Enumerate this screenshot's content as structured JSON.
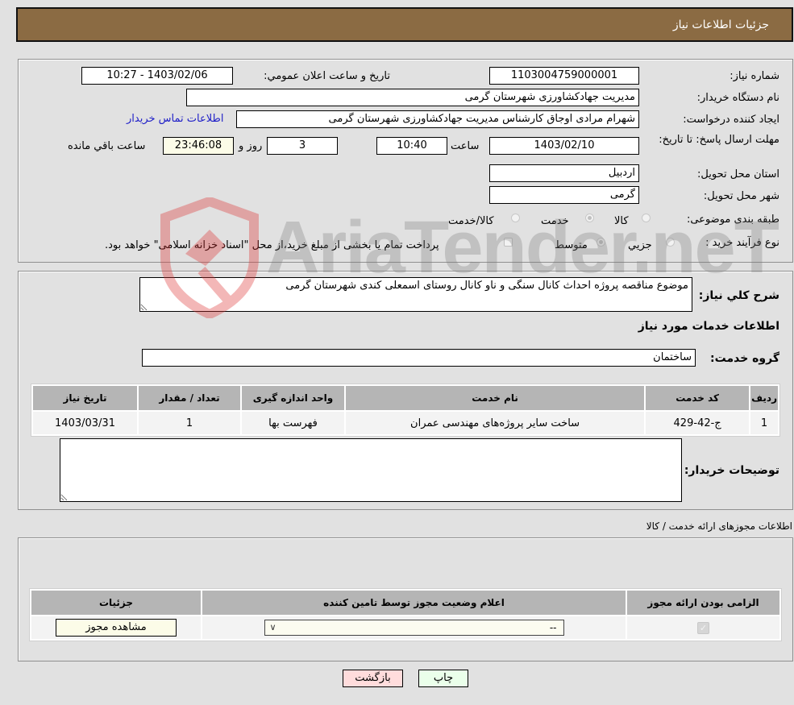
{
  "header": {
    "title": "جزئیات اطلاعات نیاز"
  },
  "form": {
    "need_number": {
      "label": "شماره نیاز:",
      "value": "1103004759000001"
    },
    "announce_datetime": {
      "label": "تاریخ و ساعت اعلان عمومي:",
      "value": "1403/02/06 - 10:27"
    },
    "buyer_org": {
      "label": "نام دستگاه خريدار:",
      "value": "مدیریت جهادکشاورزی شهرستان گرمی"
    },
    "requester": {
      "label": "ايجاد کننده درخواست:",
      "value": "شهرام  مرادی اوجاق کارشناس مدیریت جهادکشاورزی شهرستان گرمی"
    },
    "buyer_contact_link": "اطلاعات تماس خريدار",
    "deadline": {
      "label": "مهلت ارسال پاسخ: تا تاریخ:",
      "date": "1403/02/10",
      "time_label": "ساعت",
      "time": "10:40",
      "days": "3",
      "days_label": "روز و",
      "remaining": "23:46:08",
      "remaining_label": "ساعت باقي مانده"
    },
    "province": {
      "label": "استان محل تحویل:",
      "value": "اردبیل"
    },
    "city": {
      "label": "شهر محل تحویل:",
      "value": "گرمی"
    },
    "category": {
      "label": "طبقه بندی موضوعی:",
      "options": [
        {
          "label": "کالا",
          "selected": false
        },
        {
          "label": "خدمت",
          "selected": true
        },
        {
          "label": "کالا/خدمت",
          "selected": false
        }
      ]
    },
    "purchase_process": {
      "label": "نوع فرآیند خرید :",
      "options": [
        {
          "label": "جزيي",
          "selected": false
        },
        {
          "label": "متوسط",
          "selected": true
        }
      ],
      "treasury_checkbox_label": "پرداخت تمام یا بخشی از مبلغ خرید،از محل \"اسناد خزانه اسلامی\" خواهد بود.",
      "treasury_checked": false
    }
  },
  "details": {
    "description_label": "شرح کلي نياز:",
    "description_value": "موضوع مناقصه پروژه احداث کانال سنگی و ناو کانال روستای اسمعلی کندی شهرستان گرمی",
    "services_heading": "اطلاعات خدمات مورد نياز",
    "service_group_label": "گروه خدمت:",
    "service_group_value": "ساختمان",
    "table": {
      "headers": [
        "رديف",
        "کد خدمت",
        "نام خدمت",
        "واحد اندازه گيری",
        "تعداد / مقدار",
        "تاريخ نياز"
      ],
      "rows": [
        [
          "1",
          "ج-42-429",
          "ساخت سایر پروژه‌های مهندسی عمران",
          "فهرست بها",
          "1",
          "1403/03/31"
        ]
      ]
    },
    "buyer_notes_label": "توضيحات خريدار:",
    "buyer_notes_value": ""
  },
  "permits": {
    "heading": "اطلاعات مجوزهای ارائه خدمت / کالا",
    "headers": [
      "الزامی بودن ارائه مجوز",
      "اعلام وضعیت مجوز توسط تامین کننده",
      "جزئيات"
    ],
    "row": {
      "required_checked": true,
      "status_select_value": "--",
      "view_button": "مشاهده مجوز"
    }
  },
  "actions": {
    "print": "چاپ",
    "back": "بازگشت"
  },
  "watermark": {
    "text": "AriaTender.neT"
  }
}
